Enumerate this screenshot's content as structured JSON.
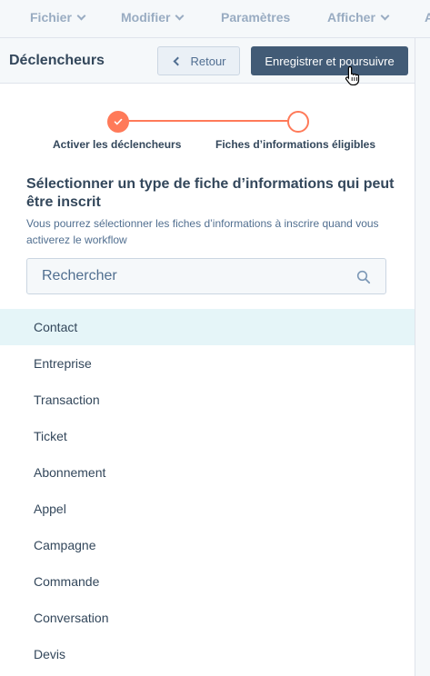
{
  "menu": {
    "items": [
      {
        "label": "Fichier",
        "has_chevron": true
      },
      {
        "label": "Modifier",
        "has_chevron": true
      },
      {
        "label": "Paramètres",
        "has_chevron": false
      },
      {
        "label": "Afficher",
        "has_chevron": true
      },
      {
        "label": "A",
        "has_chevron": false
      }
    ]
  },
  "header": {
    "title": "Déclencheurs",
    "back_label": "Retour",
    "save_label": "Enregistrer et poursuivre"
  },
  "stepper": {
    "steps": [
      {
        "label": "Activer les déclencheurs",
        "state": "done"
      },
      {
        "label": "Fiches d’informations éligibles",
        "state": "current"
      }
    ],
    "accent_color": "#ff7a59"
  },
  "section": {
    "title": "Sélectionner un type de fiche d’informations qui peut être inscrit",
    "description": "Vous pourrez sélectionner les fiches d’informations à inscrire quand vous activerez le workflow"
  },
  "search": {
    "placeholder": "Rechercher",
    "value": ""
  },
  "object_types": [
    "Contact",
    "Entreprise",
    "Transaction",
    "Ticket",
    "Abonnement",
    "Appel",
    "Campagne",
    "Commande",
    "Conversation",
    "Devis"
  ],
  "selected_index": 0,
  "colors": {
    "primary_button": "#425b76",
    "highlight_row": "#e5f5f8",
    "text": "#33475b"
  }
}
